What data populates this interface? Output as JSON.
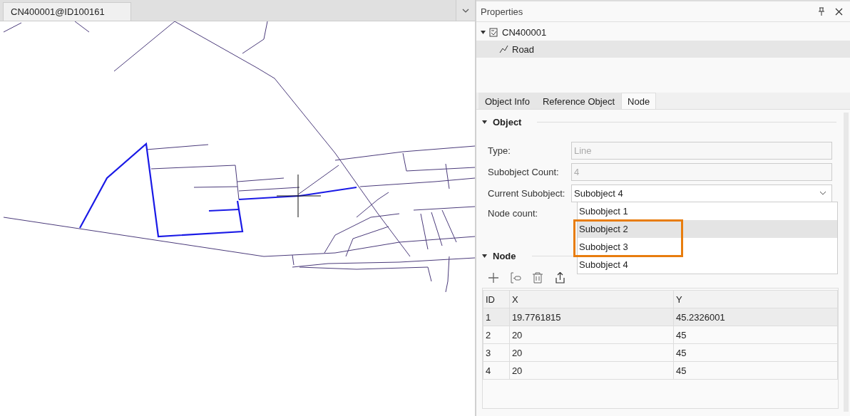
{
  "document_tab": {
    "label": "CN400001@ID100161",
    "selected": true
  },
  "properties": {
    "title": "Properties",
    "tree": [
      {
        "label": "CN400001",
        "expanded": true,
        "selected": false,
        "children": [
          {
            "label": "Road",
            "selected": true
          }
        ]
      }
    ],
    "tabs": [
      {
        "label": "Object Info",
        "selected": false
      },
      {
        "label": "Reference Object",
        "selected": false
      },
      {
        "label": "Node",
        "selected": true
      }
    ],
    "object_section": {
      "title": "Object",
      "expanded": true,
      "fields": [
        {
          "label": "Type:",
          "value": "Line",
          "disabled": true
        },
        {
          "label": "Subobject Count:",
          "value": "4",
          "disabled": true
        }
      ],
      "current_subobject": {
        "label": "Current Subobject:",
        "value": "Subobject 4",
        "open": true,
        "options": [
          {
            "label": "Subobject 1",
            "highlighted": false,
            "framed": false
          },
          {
            "label": "Subobject 2",
            "highlighted": true,
            "framed": true
          },
          {
            "label": "Subobject 3",
            "highlighted": false,
            "framed": true
          },
          {
            "label": "Subobject 4",
            "highlighted": false,
            "framed": false
          }
        ]
      },
      "node_count": {
        "label": "Node count:"
      }
    },
    "node_section": {
      "title": "Node",
      "expanded": true,
      "table": {
        "columns": [
          "ID",
          "X",
          "Y"
        ],
        "rows": [
          {
            "cells": [
              "1",
              "19.7761815",
              "45.2326001"
            ],
            "selected": true
          },
          {
            "cells": [
              "2",
              "20",
              "45"
            ],
            "selected": false
          },
          {
            "cells": [
              "3",
              "20",
              "45"
            ],
            "selected": false
          },
          {
            "cells": [
              "4",
              "20",
              "45"
            ],
            "selected": false
          }
        ]
      }
    }
  }
}
